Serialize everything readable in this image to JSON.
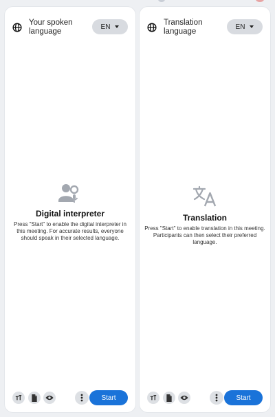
{
  "panels": [
    {
      "header_title": "Your spoken language",
      "language_code": "EN",
      "feature_icon": "person-voice-icon",
      "feature_title": "Digital interpreter",
      "feature_desc": "Press \"Start\" to enable the digital interpreter in this meeting. For accurate results, everyone should speak in their selected language.",
      "start_label": "Start"
    },
    {
      "header_title": "Translation language",
      "language_code": "EN",
      "feature_icon": "translate-icon",
      "feature_title": "Translation",
      "feature_desc": "Press \"Start\" to enable translation in this meeting. Participants can then select their preferred language.",
      "start_label": "Start"
    }
  ],
  "footer_icons": [
    "text-size-icon",
    "document-icon",
    "eye-icon",
    "more-vertical-icon"
  ],
  "colors": {
    "background": "#eef0f3",
    "panel": "#ffffff",
    "chip": "#d8dbe0",
    "accent": "#1a73d9",
    "icon_gray": "#a3a8b0"
  }
}
